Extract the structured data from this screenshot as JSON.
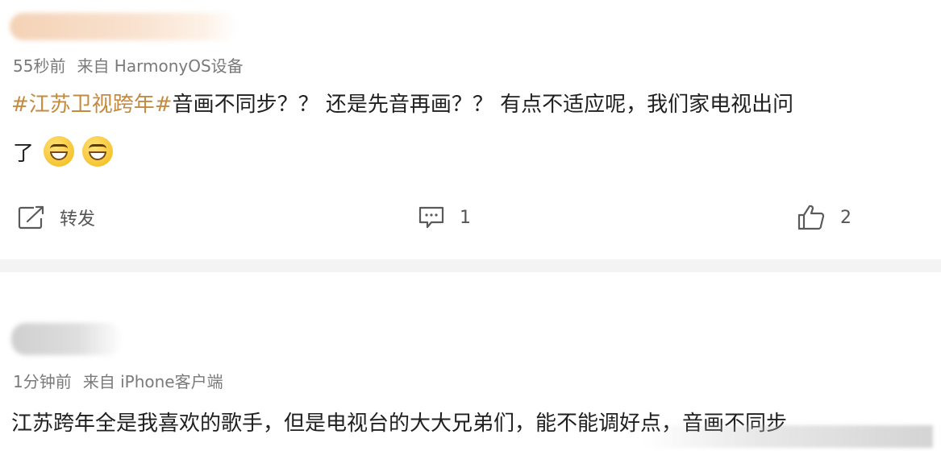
{
  "posts": [
    {
      "meta_time": "55秒前",
      "meta_source": "来自 HarmonyOS设备",
      "hashtag": "#江苏卫视跨年#",
      "content_line1": "音画不同步？？ 还是先音再画？？ 有点不适应呢，我们家电视出问",
      "content_line2": "了",
      "emojis": [
        "grin-emoji",
        "grin-emoji"
      ],
      "actions": {
        "repost_label": "转发",
        "comment_count": "1",
        "like_count": "2"
      }
    },
    {
      "meta_time": "1分钟前",
      "meta_source": "来自 iPhone客户端",
      "content_line1": "江苏跨年全是我喜欢的歌手，但是电视台的大大兄弟们，能不能调好点，音画不同步"
    }
  ],
  "colors": {
    "hashtag": "#c58a3e",
    "meta": "#7a7a7a",
    "text": "#1f1f1f",
    "separator": "#f3f3f3"
  }
}
